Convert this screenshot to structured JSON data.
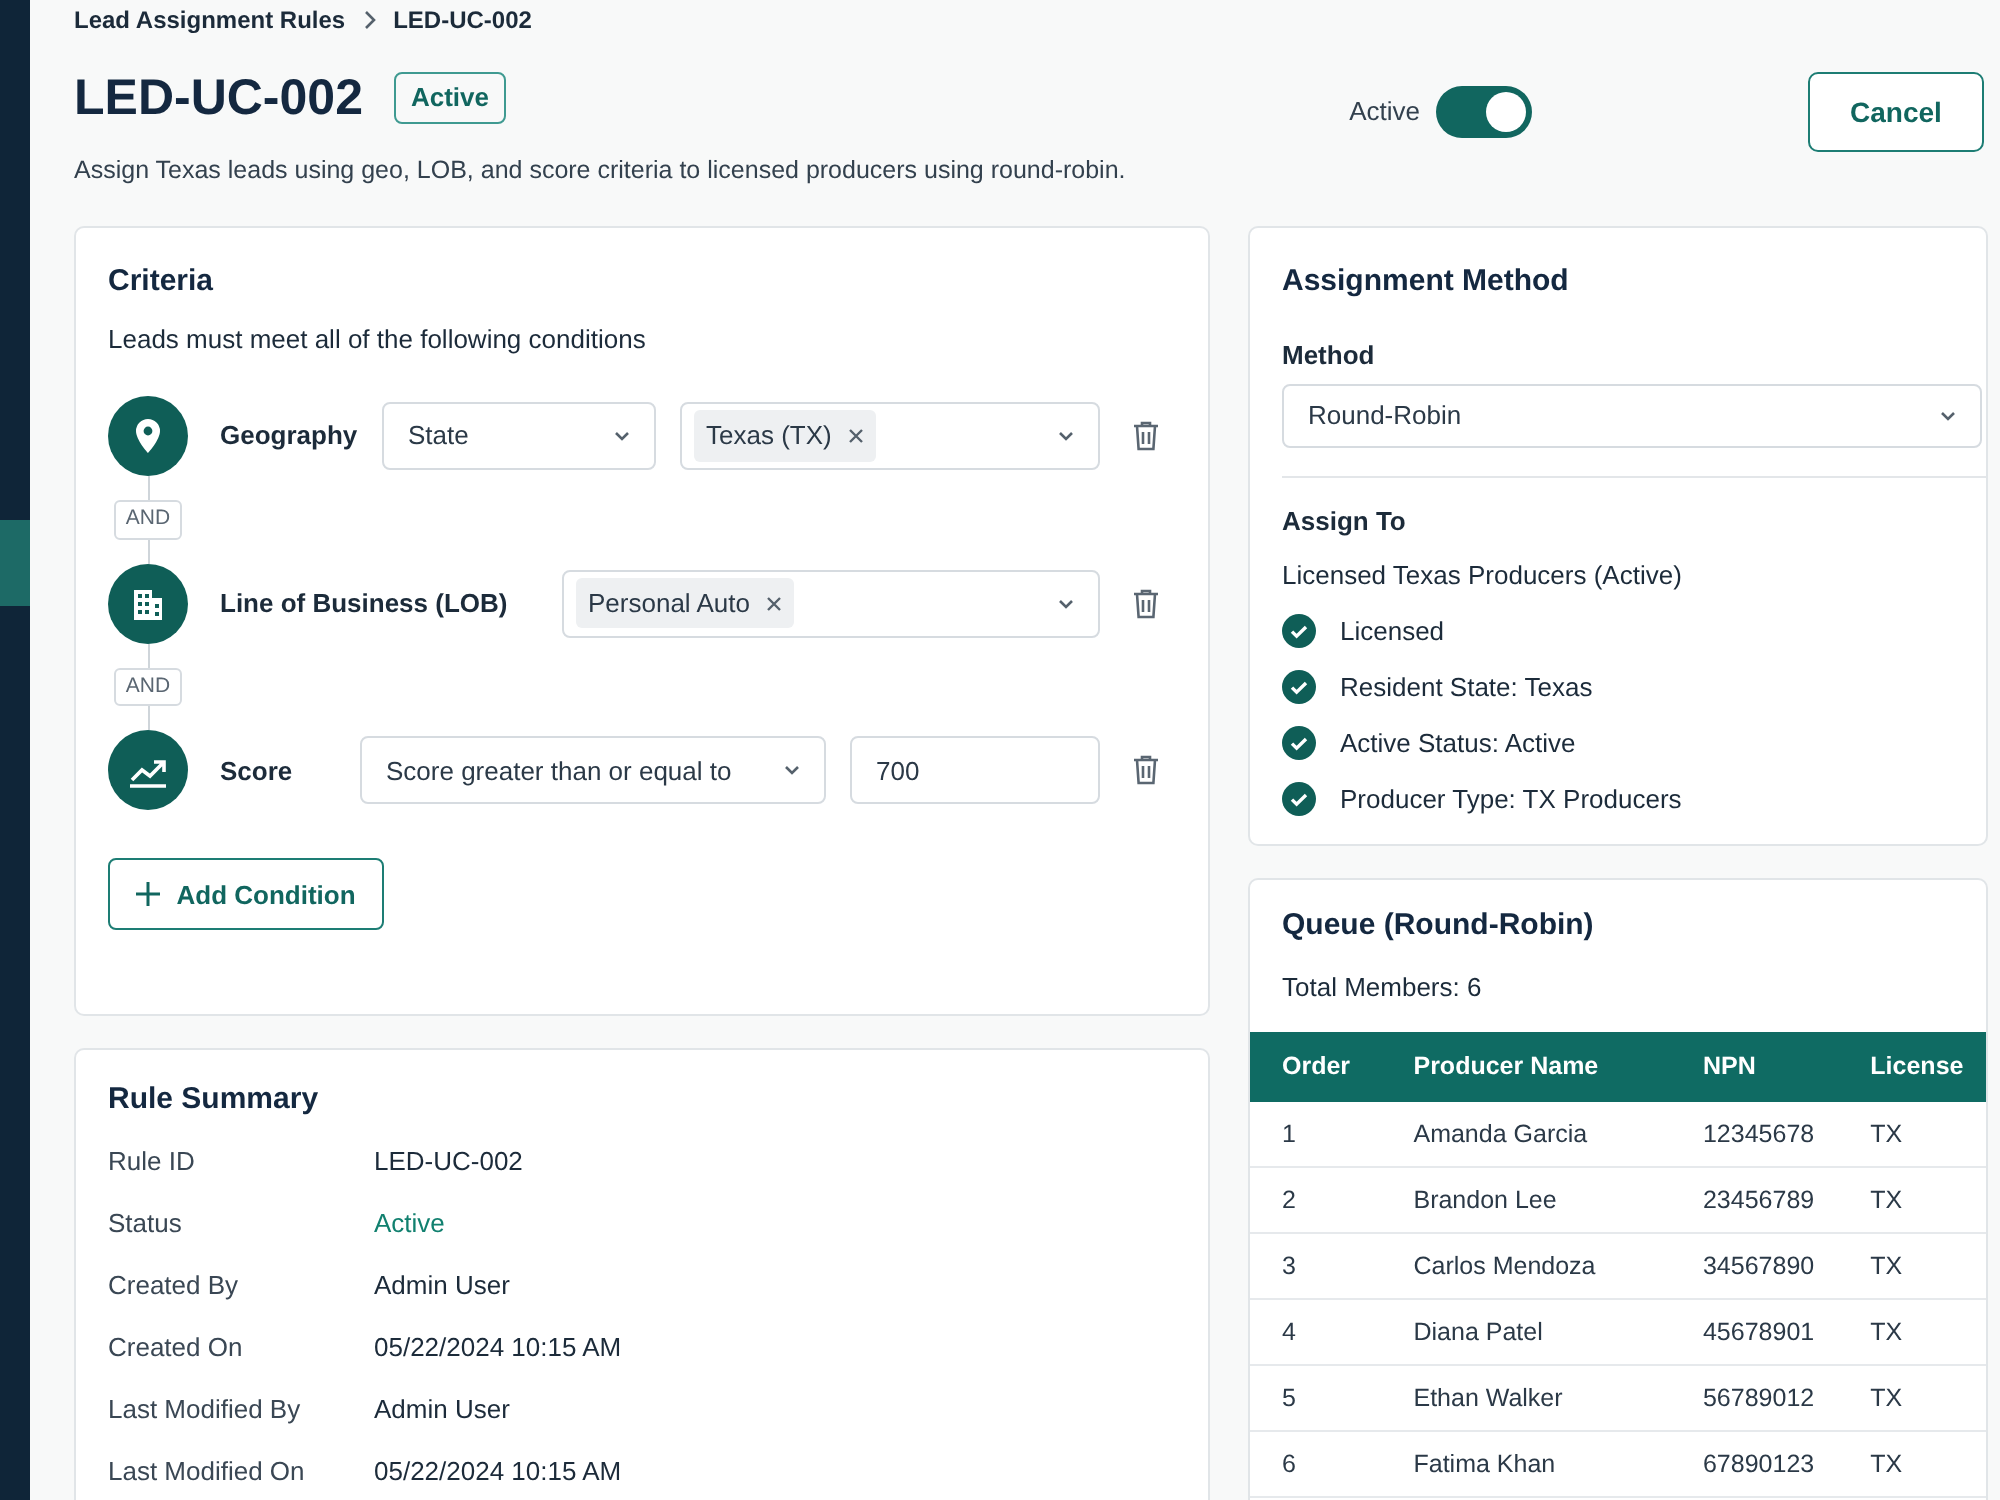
{
  "breadcrumb": [
    "Lead Assignment Rules",
    "LED-UC-002"
  ],
  "header": {
    "title": "LED-UC-002",
    "status_badge": "Active",
    "description": "Assign Texas leads using geo, LOB, and score criteria to licensed producers using round-robin.",
    "toggle": {
      "label": "Active",
      "on": true
    },
    "cancel_button": "Cancel"
  },
  "criteria": {
    "title": "Criteria",
    "subtitle": "Leads must meet all of the following conditions",
    "conditions": [
      {
        "kind": "geo",
        "label": "Geography",
        "select": "State",
        "tags": [
          "Texas (TX)"
        ]
      },
      {
        "kind": "lob",
        "connector": "AND",
        "label": "Line of Business (LOB)",
        "tags": [
          "Personal Auto"
        ]
      },
      {
        "kind": "score",
        "connector": "AND",
        "label": "Score",
        "select": "Score greater than or equal to",
        "value": "700"
      }
    ],
    "add_button": "Add Condition"
  },
  "assignment": {
    "title": "Assignment Method",
    "method_label": "Method",
    "method_value": "Round-Robin",
    "assign_to_label": "Assign To",
    "group": "Licensed Texas Producers (Active)",
    "requirements": [
      {
        "text": "Licensed",
        "checked": true
      },
      {
        "text": "Resident State: Texas",
        "checked": true
      },
      {
        "text": "Active Status: Active",
        "checked": true
      },
      {
        "text": "Producer Type: TX Producers",
        "checked": true
      }
    ]
  },
  "queue": {
    "title": "Queue (Round-Robin)",
    "total": "Total Members: 6",
    "columns": [
      "Order",
      "Producer Name",
      "NPN",
      "License"
    ],
    "rows": [
      [
        "1",
        "Amanda Garcia",
        "12345678",
        "TX"
      ],
      [
        "2",
        "Brandon Lee",
        "23456789",
        "TX"
      ],
      [
        "3",
        "Carlos Mendoza",
        "34567890",
        "TX"
      ],
      [
        "4",
        "Diana Patel",
        "45678901",
        "TX"
      ],
      [
        "5",
        "Ethan Walker",
        "56789012",
        "TX"
      ],
      [
        "6",
        "Fatima Khan",
        "67890123",
        "TX"
      ]
    ]
  },
  "summary": {
    "title": "Rule Summary",
    "rows": [
      {
        "label": "Rule ID",
        "value": "LED-UC-002",
        "kind": "text"
      },
      {
        "label": "Status",
        "value": "Active",
        "kind": "status"
      },
      {
        "label": "Created By",
        "value": "Admin User",
        "kind": "text"
      },
      {
        "label": "Created On",
        "value": "05/22/2024 10:15 AM",
        "kind": "text"
      },
      {
        "label": "Last Modified By",
        "value": "Admin User",
        "kind": "text"
      },
      {
        "label": "Last Modified On",
        "value": "05/22/2024 10:15 AM",
        "kind": "text"
      }
    ]
  }
}
